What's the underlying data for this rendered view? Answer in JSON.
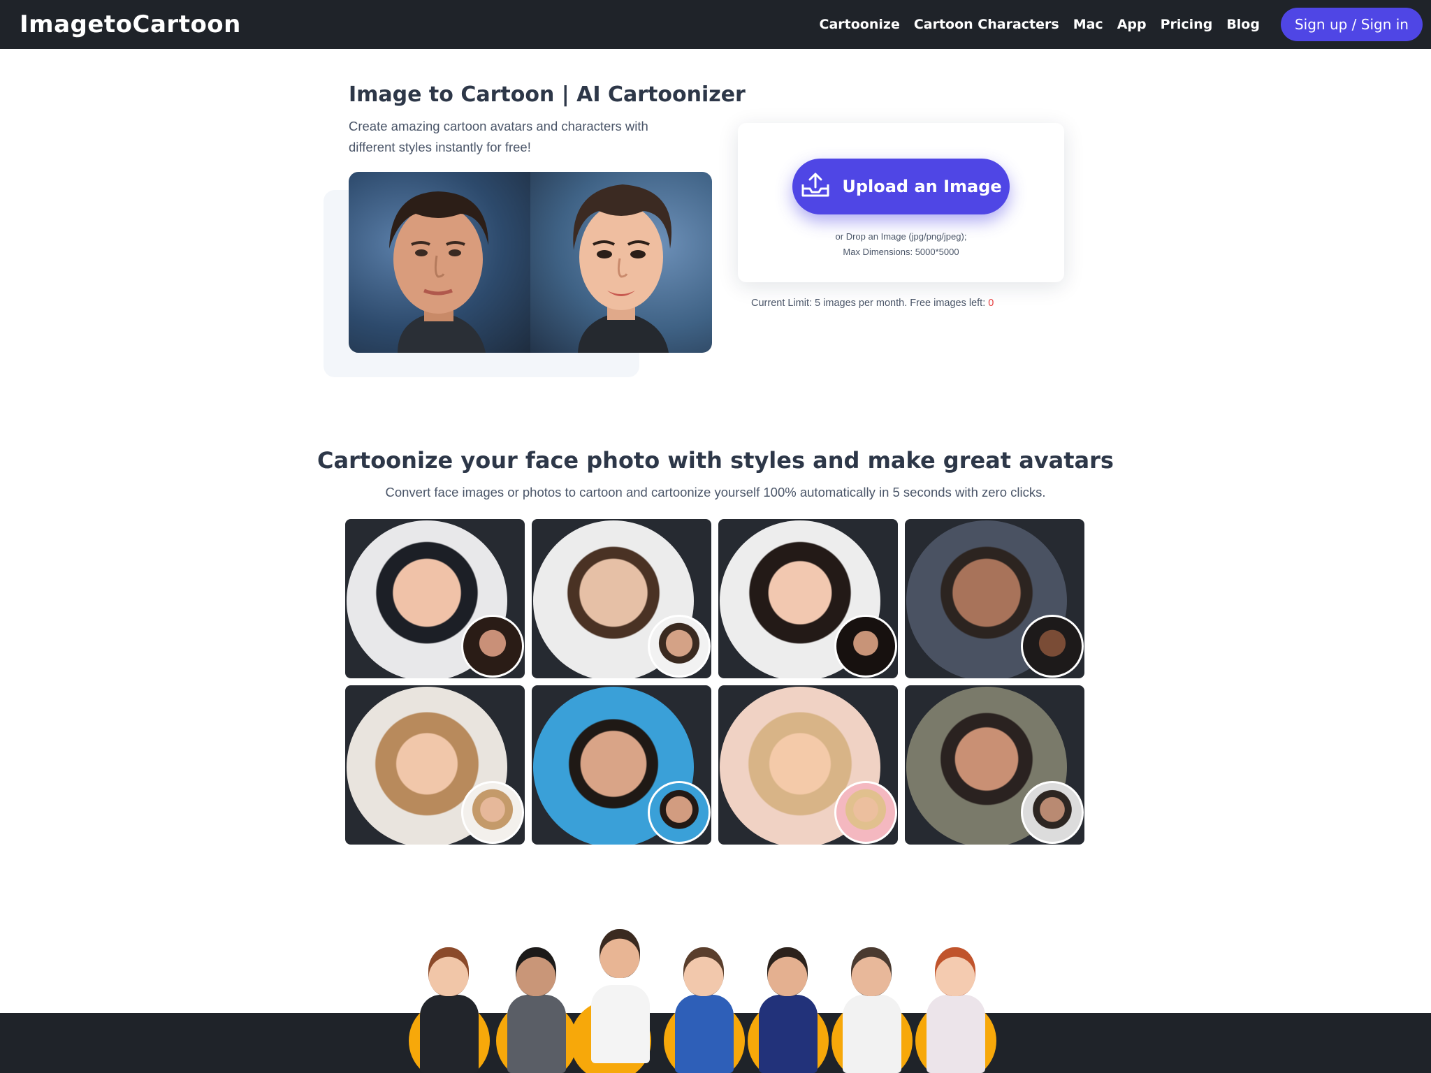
{
  "navbar": {
    "logo": "ImagetoCartoon",
    "links": [
      "Cartoonize",
      "Cartoon Characters",
      "Mac",
      "App",
      "Pricing",
      "Blog"
    ],
    "signin": "Sign up / Sign in"
  },
  "hero": {
    "title": "Image to Cartoon | AI Cartoonizer",
    "subtitle": "Create amazing cartoon avatars and characters with different styles instantly for free!"
  },
  "upload": {
    "button_label": "Upload an Image",
    "hint_line1": "or Drop an Image (jpg/png/jpeg);",
    "hint_line2": "Max Dimensions: 5000*5000",
    "limit_text": "Current Limit: 5 images per month. Free images left: ",
    "limit_count": "0"
  },
  "section": {
    "title": "Cartoonize your face photo with styles and make great avatars",
    "subtitle": "Convert face images or photos to cartoon and cartoonize yourself 100% automatically in 5 seconds with zero clicks."
  },
  "colors": {
    "nav_bg": "#1f2329",
    "accent": "#4f46e5",
    "tile_bg": "#262a31",
    "limit_count": "#e53e3e",
    "character_circle": "#f7a80a"
  }
}
